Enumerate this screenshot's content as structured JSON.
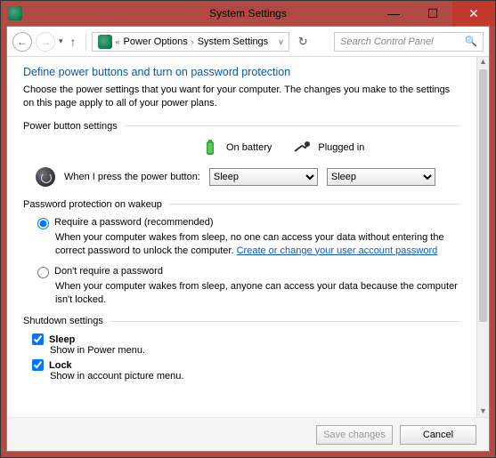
{
  "window": {
    "title": "System Settings"
  },
  "nav": {
    "breadcrumb": [
      "Power Options",
      "System Settings"
    ],
    "search_placeholder": "Search Control Panel"
  },
  "page": {
    "title": "Define power buttons and turn on password protection",
    "description": "Choose the power settings that you want for your computer. The changes you make to the settings on this page apply to all of your power plans."
  },
  "power_button": {
    "section_label": "Power button settings",
    "col_battery": "On battery",
    "col_plugged": "Plugged in",
    "row_label": "When I press the power button:",
    "value_battery": "Sleep",
    "value_plugged": "Sleep"
  },
  "password": {
    "section_label": "Password protection on wakeup",
    "require_label": "Require a password (recommended)",
    "require_desc_pre": "When your computer wakes from sleep, no one can access your data without entering the correct password to unlock the computer. ",
    "require_link": "Create or change your user account password",
    "dont_label": "Don't require a password",
    "dont_desc": "When your computer wakes from sleep, anyone can access your data because the computer isn't locked."
  },
  "shutdown": {
    "section_label": "Shutdown settings",
    "sleep_label": "Sleep",
    "sleep_desc": "Show in Power menu.",
    "lock_label": "Lock",
    "lock_desc": "Show in account picture menu."
  },
  "footer": {
    "save": "Save changes",
    "cancel": "Cancel"
  }
}
